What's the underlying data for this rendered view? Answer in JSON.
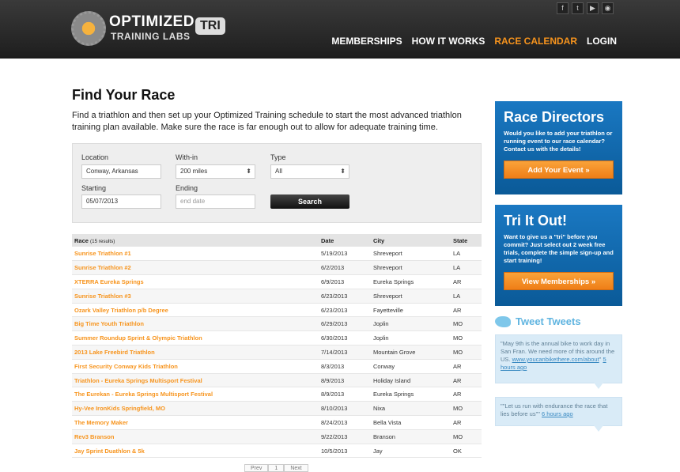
{
  "header": {
    "logo_line1": "OPTIMIZED",
    "logo_line2": "TRAINING LABS",
    "logo_badge": "TRI",
    "social": [
      "facebook-icon",
      "twitter-icon",
      "youtube-icon",
      "rss-icon"
    ],
    "nav": [
      {
        "label": "MEMBERSHIPS",
        "active": false
      },
      {
        "label": "HOW IT WORKS",
        "active": false
      },
      {
        "label": "RACE CALENDAR",
        "active": true
      },
      {
        "label": "LOGIN",
        "active": false
      }
    ]
  },
  "page": {
    "title": "Find Your Race",
    "intro": "Find a triathlon and then set up your Optimized Training schedule to start the most advanced triathlon training plan available. Make sure the race is far enough out to allow for adequate training time."
  },
  "search": {
    "location_label": "Location",
    "location_value": "Conway, Arkansas",
    "within_label": "With-in",
    "within_value": "200 miles",
    "type_label": "Type",
    "type_value": "All",
    "starting_label": "Starting",
    "starting_value": "05/07/2013",
    "ending_label": "Ending",
    "ending_placeholder": "end date",
    "button": "Search"
  },
  "table": {
    "header_race": "Race",
    "results_count": "(15 results)",
    "header_date": "Date",
    "header_city": "City",
    "header_state": "State",
    "rows": [
      {
        "race": "Sunrise Triathlon #1",
        "date": "5/19/2013",
        "city": "Shreveport",
        "state": "LA"
      },
      {
        "race": "Sunrise Triathlon #2",
        "date": "6/2/2013",
        "city": "Shreveport",
        "state": "LA"
      },
      {
        "race": "XTERRA Eureka Springs",
        "date": "6/9/2013",
        "city": "Eureka Springs",
        "state": "AR"
      },
      {
        "race": "Sunrise Triathlon #3",
        "date": "6/23/2013",
        "city": "Shreveport",
        "state": "LA"
      },
      {
        "race": "Ozark Valley Triathlon p/b Degree",
        "date": "6/23/2013",
        "city": "Fayetteville",
        "state": "AR"
      },
      {
        "race": "Big Time Youth Triathlon",
        "date": "6/29/2013",
        "city": "Joplin",
        "state": "MO"
      },
      {
        "race": "Summer Roundup Sprint & Olympic Triathlon",
        "date": "6/30/2013",
        "city": "Joplin",
        "state": "MO"
      },
      {
        "race": "2013 Lake Freebird Triathlon",
        "date": "7/14/2013",
        "city": "Mountain Grove",
        "state": "MO"
      },
      {
        "race": "First Security Conway Kids Triathlon",
        "date": "8/3/2013",
        "city": "Conway",
        "state": "AR"
      },
      {
        "race": "Triathlon - Eureka Springs Multisport Festival",
        "date": "8/9/2013",
        "city": "Holiday Island",
        "state": "AR"
      },
      {
        "race": "The Eurekan - Eureka Springs Multisport Festival",
        "date": "8/9/2013",
        "city": "Eureka Springs",
        "state": "AR"
      },
      {
        "race": "Hy-Vee IronKids Springfield, MO",
        "date": "8/10/2013",
        "city": "Nixa",
        "state": "MO"
      },
      {
        "race": "The Memory Maker",
        "date": "8/24/2013",
        "city": "Bella Vista",
        "state": "AR"
      },
      {
        "race": "Rev3 Branson",
        "date": "9/22/2013",
        "city": "Branson",
        "state": "MO"
      },
      {
        "race": "Jay Sprint Duathlon & 5k",
        "date": "10/5/2013",
        "city": "Jay",
        "state": "OK"
      }
    ]
  },
  "pager": {
    "prev": "Prev",
    "page": "1",
    "next": "Next"
  },
  "sidebar": {
    "directors": {
      "title": "Race Directors",
      "text": "Would you like to add your triathlon or running event to our race calendar? Contact us with the details!",
      "button": "Add Your Event »"
    },
    "tri": {
      "title": "Tri It Out!",
      "text": "Want to give us a \"tri\" before you commit? Just select out 2 week free trials, complete the simple sign-up and start training!",
      "button": "View Memberships »"
    },
    "tweets_title": "Tweet Tweets",
    "tweet1_text": "\"May 9th is the annual bike to work day in San Fran. We need more of this around the US.",
    "tweet1_link": "www.youcanbikethere.com/about",
    "tweet1_quote": "\"",
    "tweet1_time": "5 hours ago",
    "tweet2_text": "\"\"Let us run with endurance the race that lies before us\"\"",
    "tweet2_time": "6 hours ago"
  },
  "colors": {
    "accent": "#f7941d",
    "panel_blue": "#0a5a98",
    "tweet_bg": "#d9ebf7"
  }
}
